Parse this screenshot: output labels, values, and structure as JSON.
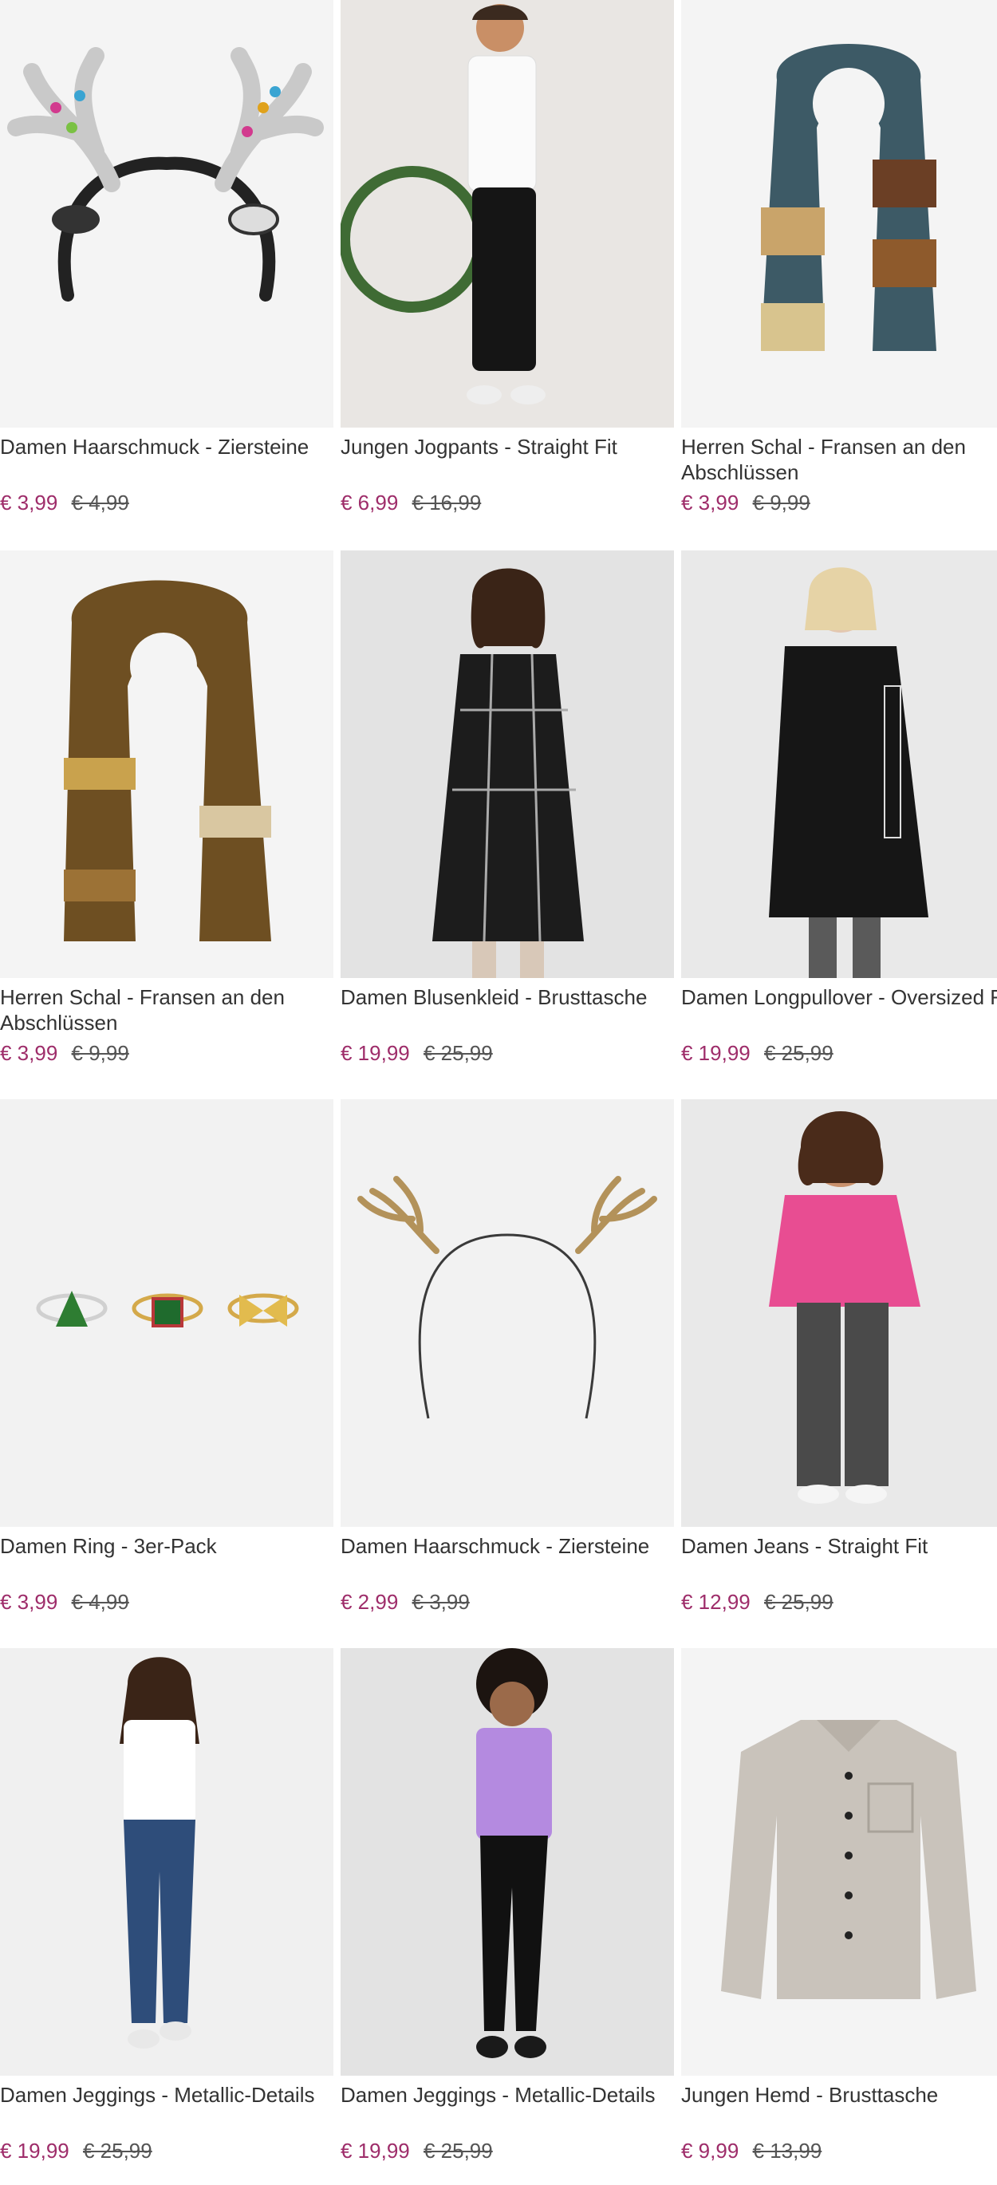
{
  "colors": {
    "sale_price": "#9e2d6a",
    "old_price": "#555555",
    "image_bg": "#f2f2f2"
  },
  "products": [
    {
      "title": "Damen Haarschmuck - Ziersteine",
      "price": "€ 3,99",
      "old_price": "€ 4,99",
      "image": "antler-headband-sequin"
    },
    {
      "title": "Jungen Jogpants - Straight Fit",
      "price": "€ 6,99",
      "old_price": "€ 16,99",
      "image": "boy-white-shirt-black-pants"
    },
    {
      "title": "Herren Schal - Fransen an den Abschlüssen",
      "price": "€ 3,99",
      "old_price": "€ 9,99",
      "image": "checked-scarf-multicolor"
    },
    {
      "title": "Herren Schal - Fransen an den Abschlüssen",
      "price": "€ 3,99",
      "old_price": "€ 9,99",
      "image": "checked-scarf-brown"
    },
    {
      "title": "Damen Blusenkleid - Brusttasche",
      "price": "€ 19,99",
      "old_price": "€ 25,99",
      "image": "woman-black-plaid-dress"
    },
    {
      "title": "Damen Longpullover - Oversized Fit",
      "price": "€ 19,99",
      "old_price": "€ 25,99",
      "image": "woman-black-longpullover"
    },
    {
      "title": "Damen Ring - 3er-Pack",
      "price": "€ 3,99",
      "old_price": "€ 4,99",
      "image": "three-christmas-rings"
    },
    {
      "title": "Damen Haarschmuck - Ziersteine",
      "price": "€ 2,99",
      "old_price": "€ 3,99",
      "image": "antler-headband-gold"
    },
    {
      "title": "Damen Jeans - Straight Fit",
      "price": "€ 12,99",
      "old_price": "€ 25,99",
      "image": "woman-pink-sweater-jeans"
    },
    {
      "title": "Damen Jeggings - Metallic-Details",
      "price": "€ 19,99",
      "old_price": "€ 25,99",
      "image": "woman-white-top-blue-jeggings"
    },
    {
      "title": "Damen Jeggings - Metallic-Details",
      "price": "€ 19,99",
      "old_price": "€ 25,99",
      "image": "woman-lilac-tee-black-jeggings"
    },
    {
      "title": "Jungen Hemd - Brusttasche",
      "price": "€ 9,99",
      "old_price": "€ 13,99",
      "image": "beige-shirt-brusttasche"
    }
  ]
}
